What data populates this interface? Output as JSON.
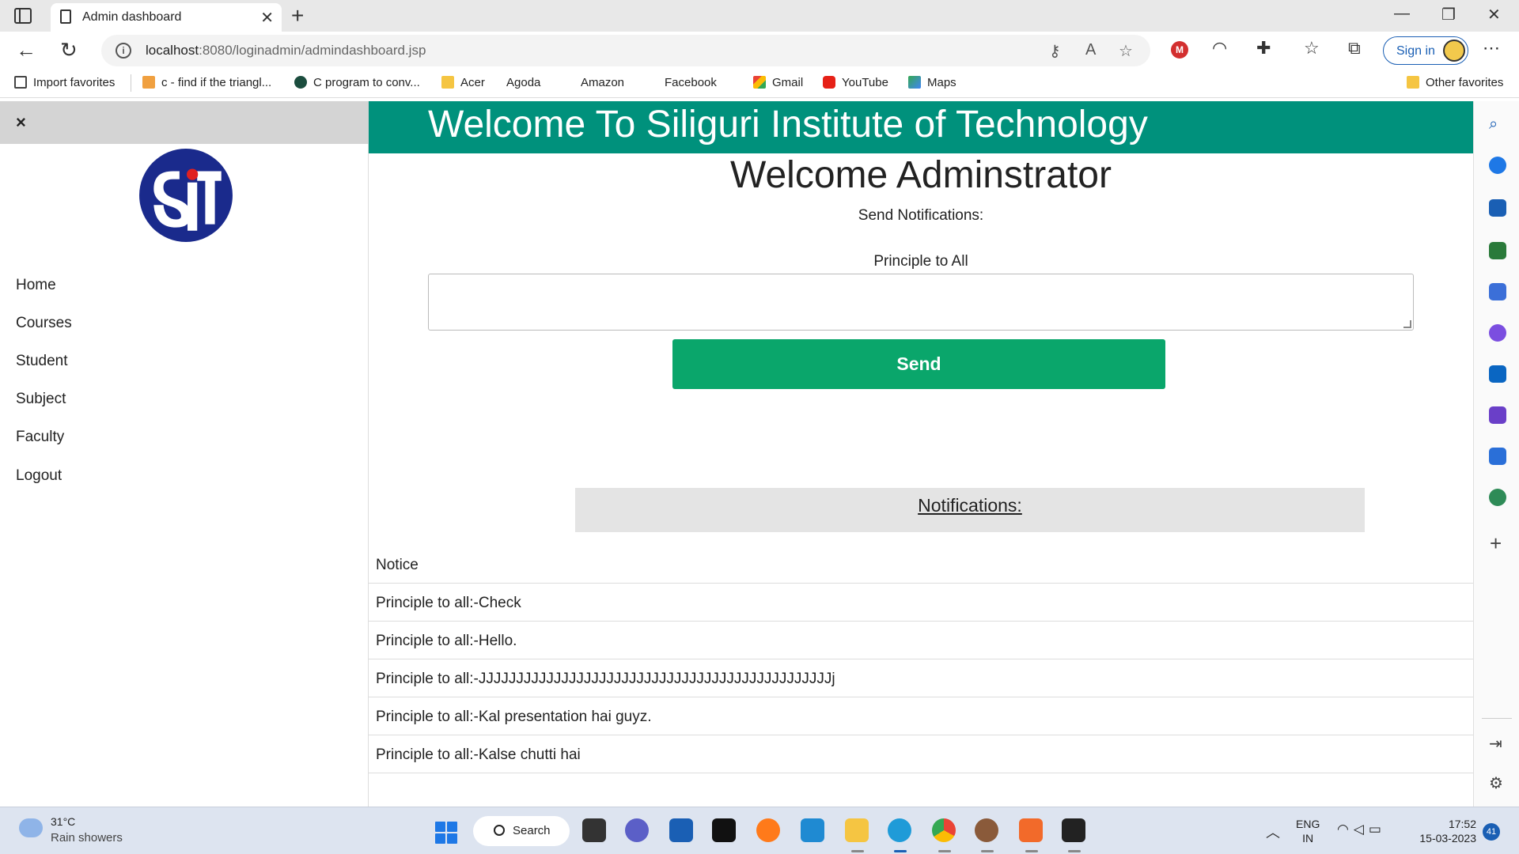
{
  "browser": {
    "tab_title": "Admin dashboard",
    "url_host": "localhost",
    "url_path": ":8080/loginadmin/admindashboard.jsp",
    "signin_label": "Sign in"
  },
  "favorites": {
    "items": [
      "Import favorites",
      "c - find if the triangl...",
      "C program to conv...",
      "Acer",
      "Agoda",
      "Amazon",
      "Facebook",
      "Gmail",
      "YouTube",
      "Maps"
    ],
    "other": "Other favorites"
  },
  "sidebar": {
    "close_glyph": "×",
    "items": [
      "Home",
      "Courses",
      "Student",
      "Subject",
      "Faculty",
      "Logout"
    ]
  },
  "main": {
    "banner_title": "Welcome To Siliguri Institute of Technology",
    "welcome": "Welcome Adminstrator",
    "send_label": "Send Notifications:",
    "input_label": "Principle to All",
    "textarea_value": "",
    "send_button": "Send",
    "notifications_title": "Notifications:",
    "notice_header": "Notice",
    "notices": [
      "Principle to all:-Check",
      "Principle to all:-Hello.",
      "Principle to all:-JJJJJJJJJJJJJJJJJJJJJJJJJJJJJJJJJJJJJJJJJJJJJJJj",
      "Principle to all:-Kal presentation hai guyz.",
      "Principle to all:-Kalse chutti hai"
    ]
  },
  "taskbar": {
    "temperature": "31°C",
    "weather": "Rain showers",
    "search_label": "Search",
    "lang_1": "ENG",
    "lang_2": "IN",
    "time": "17:52",
    "date": "15-03-2023",
    "notification_count": "41"
  },
  "colors": {
    "banner": "#00917c",
    "send_button": "#0aa66b",
    "logo_blue": "#1a2a8c",
    "logo_red": "#e02020"
  }
}
